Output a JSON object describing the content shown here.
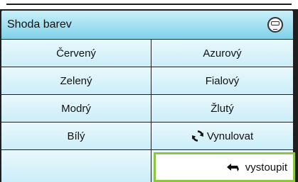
{
  "menu": {
    "title": "Shoda barev",
    "header_icon": "remote-control-icon"
  },
  "grid": {
    "red": "Červený",
    "cyan": "Azurový",
    "green": "Zelený",
    "magenta": "Fialový",
    "blue": "Modrý",
    "yellow": "Žlutý",
    "white": "Bílý",
    "reset": "Vynulovat",
    "exit": "vystoupit"
  },
  "icons": {
    "reset": "refresh-icon",
    "exit": "return-arrow-icon"
  },
  "colors": {
    "header_gradient_bottom": "#7fd1ea",
    "cell_background": "#dff5fb",
    "selection_border": "#8cc63f"
  }
}
